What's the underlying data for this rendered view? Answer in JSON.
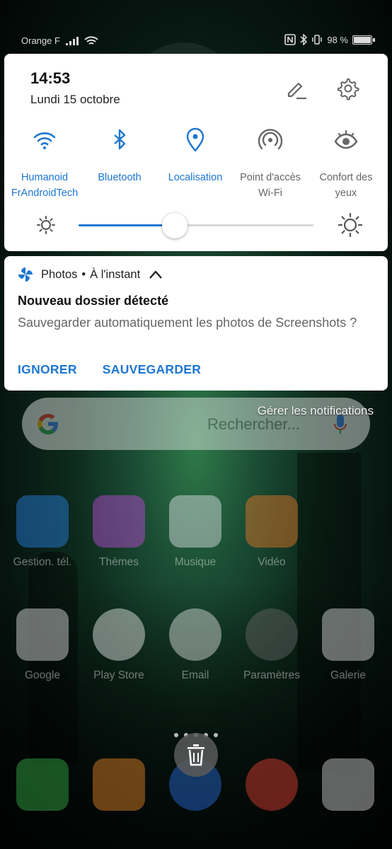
{
  "status_bar": {
    "carrier": "Orange F",
    "battery_text": "98 %",
    "battery_level": 0.98
  },
  "quick_settings": {
    "time": "14:53",
    "date": "Lundi 15 octobre",
    "tiles": [
      {
        "id": "wifi",
        "label_line1": "Humanoid",
        "label_line2": "FrAndroidTech",
        "active": true,
        "icon": "wifi-icon"
      },
      {
        "id": "bluetooth",
        "label_line1": "Bluetooth",
        "label_line2": "",
        "active": true,
        "icon": "bluetooth-icon"
      },
      {
        "id": "location",
        "label_line1": "Localisation",
        "label_line2": "",
        "active": true,
        "icon": "location-pin-icon"
      },
      {
        "id": "hotspot",
        "label_line1": "Point d'accès",
        "label_line2": "Wi-Fi",
        "active": false,
        "icon": "hotspot-icon"
      },
      {
        "id": "eye_comfort",
        "label_line1": "Confort des",
        "label_line2": "yeux",
        "active": false,
        "icon": "eye-icon"
      }
    ],
    "brightness_level": 0.41
  },
  "notification": {
    "app_name": "Photos",
    "separator": "•",
    "time": "À l'instant",
    "title": "Nouveau dossier détecté",
    "body": "Sauvegarder automatiquement les photos de Screenshots ?",
    "actions": [
      "IGNORER",
      "SAUVEGARDER"
    ]
  },
  "manage_notifications": "Gérer les notifications",
  "home": {
    "search_placeholder": "Rechercher...",
    "apps_row1": [
      {
        "label": "Gestion. tél.",
        "icon": "phone-manager-icon",
        "color": "#2a84e8"
      },
      {
        "label": "Thèmes",
        "icon": "themes-icon",
        "color": "#c64be0"
      },
      {
        "label": "Musique",
        "icon": "music-icon",
        "color": "#e8e8f0"
      },
      {
        "label": "Vidéo",
        "icon": "video-icon",
        "color": "#f07a28"
      }
    ],
    "apps_row2": [
      {
        "label": "Google",
        "icon": "google-folder-icon",
        "color": "#e8e8e8"
      },
      {
        "label": "Play Store",
        "icon": "play-store-icon",
        "color": "#f4f4f4"
      },
      {
        "label": "Email",
        "icon": "email-icon",
        "color": "#e6e6e6"
      },
      {
        "label": "Paramètres",
        "icon": "settings-app-icon",
        "color": "#6a6a6a"
      },
      {
        "label": "Galerie",
        "icon": "gallery-icon",
        "color": "#e4e4e4"
      }
    ],
    "dock": [
      {
        "icon": "phone-icon",
        "color": "#37b44a"
      },
      {
        "icon": "contacts-icon",
        "color": "#f08a2a"
      },
      {
        "icon": "messages-icon",
        "color": "#2a6ee0"
      },
      {
        "icon": "chrome-icon",
        "color": "#e84235"
      },
      {
        "icon": "camera-icon",
        "color": "#d8d8d8"
      }
    ]
  },
  "colors": {
    "accent": "#1d76d2",
    "inactive": "#666666"
  }
}
